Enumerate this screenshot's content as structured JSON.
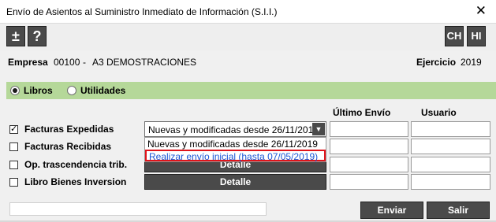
{
  "window": {
    "title": "Envío de Asientos al Suministro Inmediato de Información (S.I.I.)",
    "close_glyph": "✕"
  },
  "toolbar": {
    "plusminus_glyph": "±",
    "help_glyph": "?",
    "ch_label": "CH",
    "hi_label": "HI"
  },
  "info": {
    "empresa_label": "Empresa",
    "empresa_code": "00100",
    "empresa_sep": "-",
    "empresa_name": "A3 DEMOSTRACIONES",
    "ejercicio_label": "Ejercicio",
    "ejercicio_value": "2019"
  },
  "tabs": [
    {
      "label": "Libros",
      "selected": true
    },
    {
      "label": "Utilidades",
      "selected": false
    }
  ],
  "columns": {
    "ultimo_envio": "Último Envío",
    "usuario": "Usuario"
  },
  "rows": [
    {
      "label": "Facturas Expedidas",
      "checked": true,
      "check_glyph": "✓"
    },
    {
      "label": "Facturas Recibidas",
      "checked": false
    },
    {
      "label": "Op. trascendencia trib.",
      "checked": false
    },
    {
      "label": "Libro Bienes Inversion",
      "checked": false
    }
  ],
  "select": {
    "value": "Nuevas y modificadas desde 26/11/2019",
    "arrow_glyph": "▼",
    "options": [
      "Nuevas y modificadas desde 26/11/2019",
      "Realizar envío inicial (hasta 07/05/2019)"
    ],
    "highlight_color": "#e0141b"
  },
  "detalle_label": "Detalle",
  "buttons": {
    "enviar": "Enviar",
    "salir": "Salir"
  },
  "colors": {
    "tab_bar": "#b5d899",
    "dark_button": "#4a4a4a"
  }
}
